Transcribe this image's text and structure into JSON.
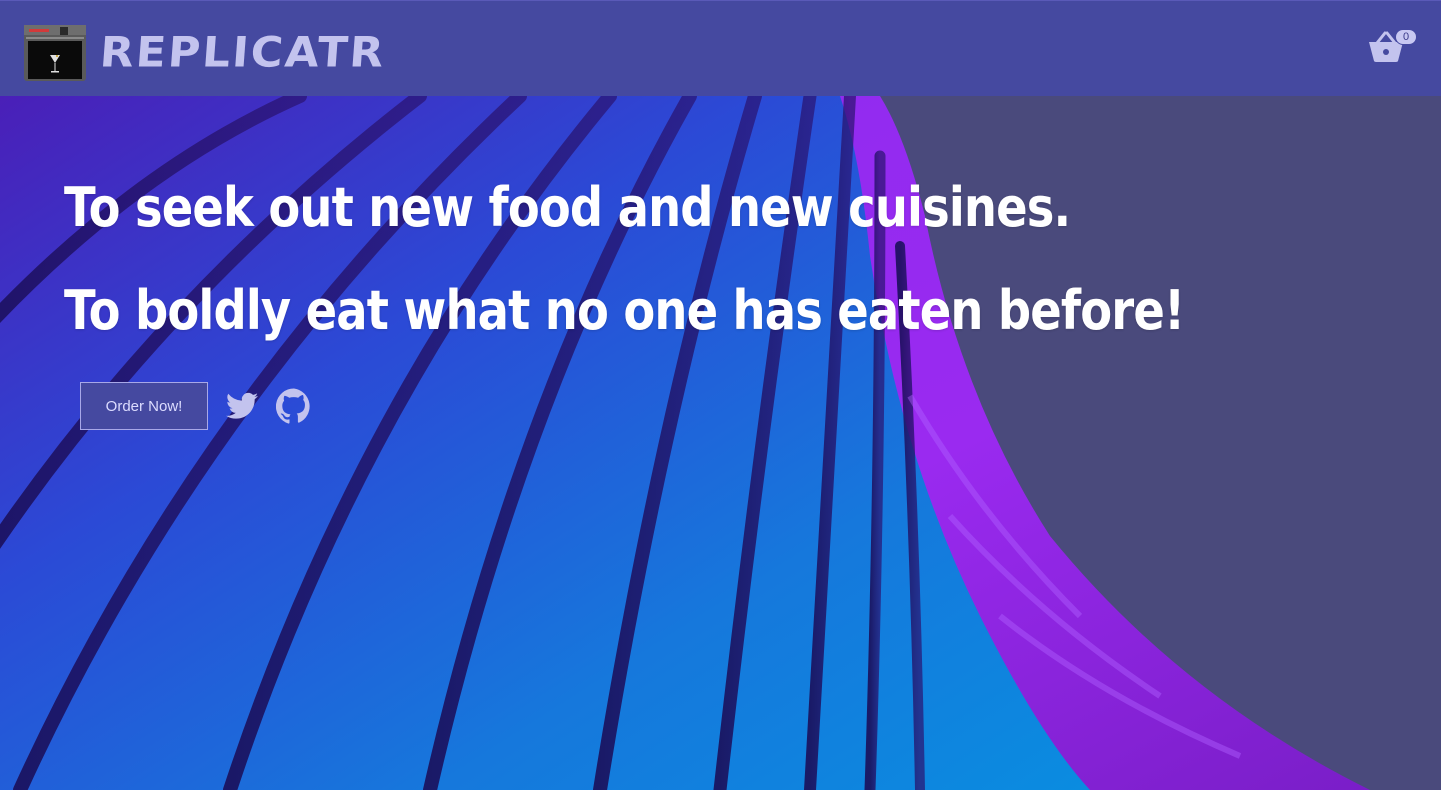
{
  "header": {
    "brand": "REPLICATR",
    "logo_icon": "replicator-machine-icon",
    "cart_icon": "basket-icon",
    "cart_count": "0"
  },
  "hero": {
    "headline_1": "To seek out new food and new cuisines.",
    "headline_2": "To boldly eat what no one has eaten before!",
    "order_button": "Order Now!",
    "social_links": [
      {
        "icon": "twitter-icon"
      },
      {
        "icon": "github-icon"
      }
    ]
  },
  "colors": {
    "header_bg": "#4549a0",
    "brand_text": "#c3c3ee",
    "icon_color": "#c3c3ee",
    "hero_backdrop": "#4a4a7c",
    "headline_text": "#ffffff"
  }
}
